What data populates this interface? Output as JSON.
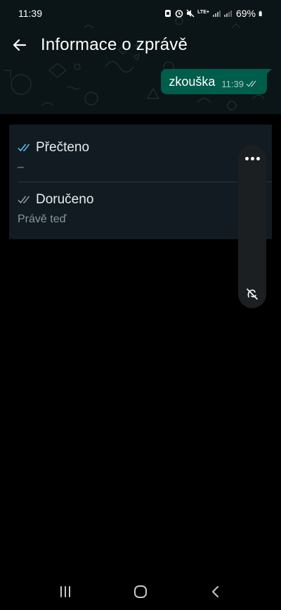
{
  "status_bar": {
    "time": "11:39",
    "network": "LTE+",
    "battery": "69%"
  },
  "header": {
    "title": "Informace o zprávě",
    "back_icon": "arrow-left-icon"
  },
  "message": {
    "text": "zkouška",
    "time": "11:39",
    "status_icon": "double-check-icon"
  },
  "info": {
    "read": {
      "label": "Přečteno",
      "value": "–",
      "icon": "double-check-blue-icon",
      "icon_color": "#53bdeb"
    },
    "delivered": {
      "label": "Doručeno",
      "value": "Právě teď",
      "icon": "double-check-gray-icon",
      "icon_color": "#8696a0"
    }
  },
  "side_panel": {
    "menu_icon": "more-horizontal-icon",
    "bottom_icon": "edge-panel-off-icon"
  },
  "nav_bar": {
    "recents_icon": "recents-icon",
    "home_icon": "home-icon",
    "back_icon": "nav-back-icon"
  },
  "colors": {
    "background": "#000000",
    "bubble": "#005c4b",
    "card": "#121b22",
    "read_tick": "#53bdeb"
  }
}
